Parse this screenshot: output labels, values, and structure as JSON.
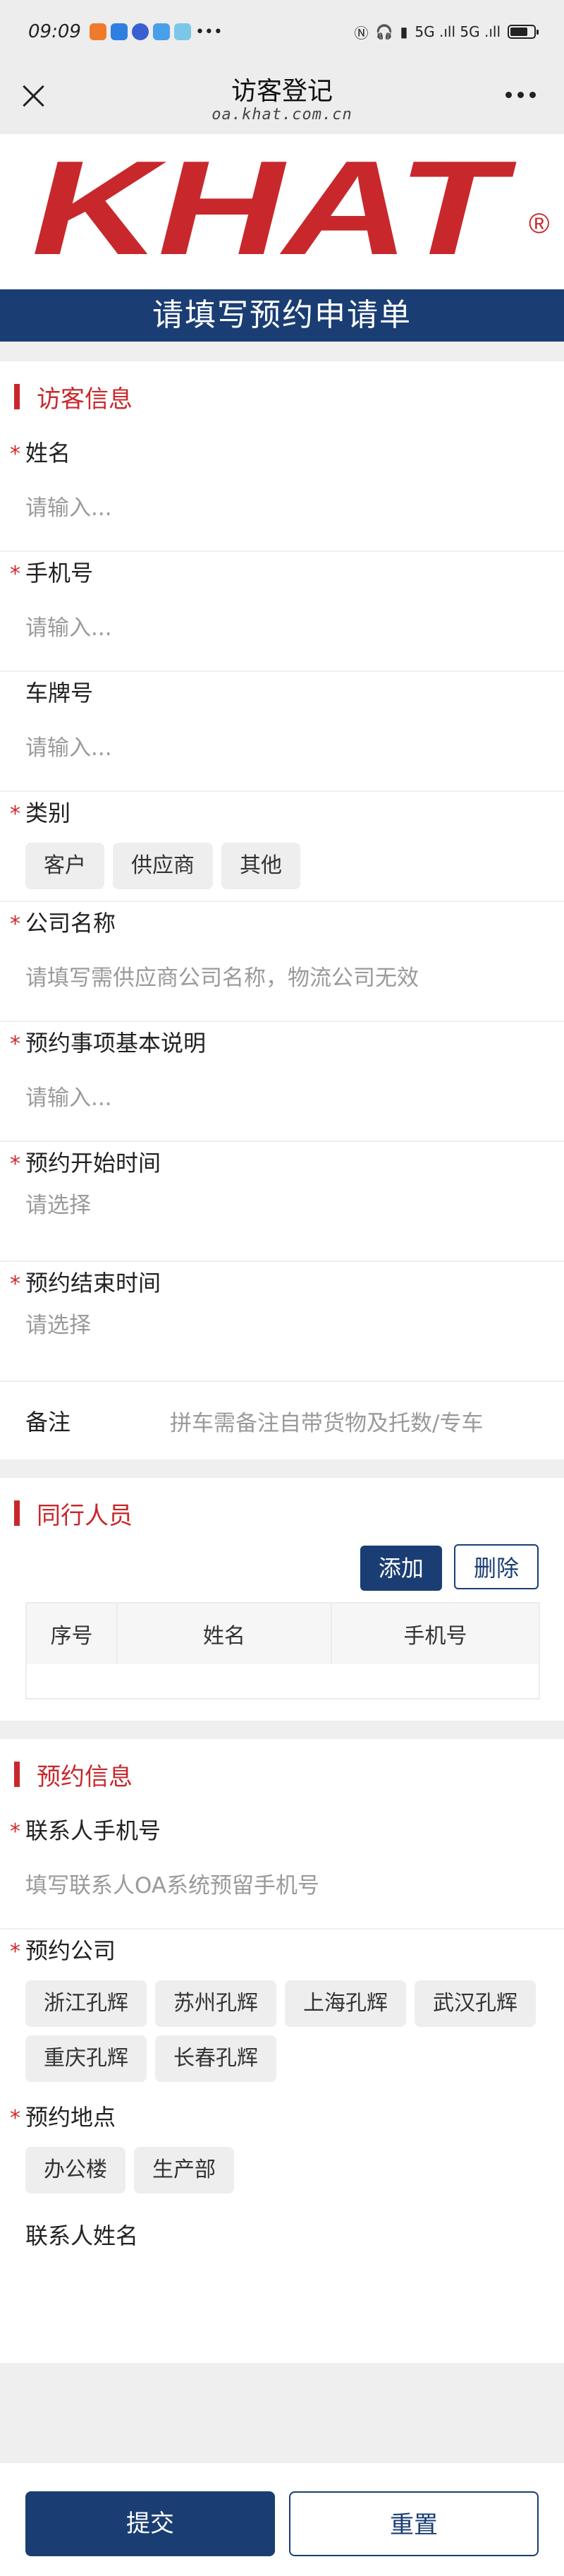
{
  "status": {
    "time": "09:09",
    "signal": "5G .ıll 5G .ıll"
  },
  "nav": {
    "title": "访客登记",
    "subtitle": "oa.khat.com.cn"
  },
  "logo": {
    "text": "KHAT",
    "reg": "®"
  },
  "banner": "请填写预约申请单",
  "visitor": {
    "title": "访客信息",
    "name_label": "姓名",
    "name_placeholder": "请输入...",
    "phone_label": "手机号",
    "phone_placeholder": "请输入...",
    "plate_label": "车牌号",
    "plate_placeholder": "请输入...",
    "type_label": "类别",
    "types": [
      "客户",
      "供应商",
      "其他"
    ],
    "company_label": "公司名称",
    "company_placeholder": "请填写需供应商公司名称，物流公司无效",
    "purpose_label": "预约事项基本说明",
    "purpose_placeholder": "请输入...",
    "start_label": "预约开始时间",
    "start_placeholder": "请选择",
    "end_label": "预约结束时间",
    "end_placeholder": "请选择",
    "remark_label": "备注",
    "remark_placeholder": "拼车需备注自带货物及托数/专车"
  },
  "companions": {
    "title": "同行人员",
    "add_label": "添加",
    "delete_label": "删除",
    "columns": [
      "序号",
      "姓名",
      "手机号"
    ]
  },
  "booking": {
    "title": "预约信息",
    "contact_phone_label": "联系人手机号",
    "contact_phone_placeholder": "填写联系人OA系统预留手机号",
    "company_label": "预约公司",
    "companies": [
      "浙江孔辉",
      "苏州孔辉",
      "上海孔辉",
      "武汉孔辉",
      "重庆孔辉",
      "长春孔辉"
    ],
    "location_label": "预约地点",
    "locations": [
      "办公楼",
      "生产部"
    ],
    "contact_name_label": "联系人姓名"
  },
  "footer": {
    "submit": "提交",
    "reset": "重置"
  },
  "colors": {
    "primary": "#1a3e73",
    "accent": "#c8282c"
  }
}
